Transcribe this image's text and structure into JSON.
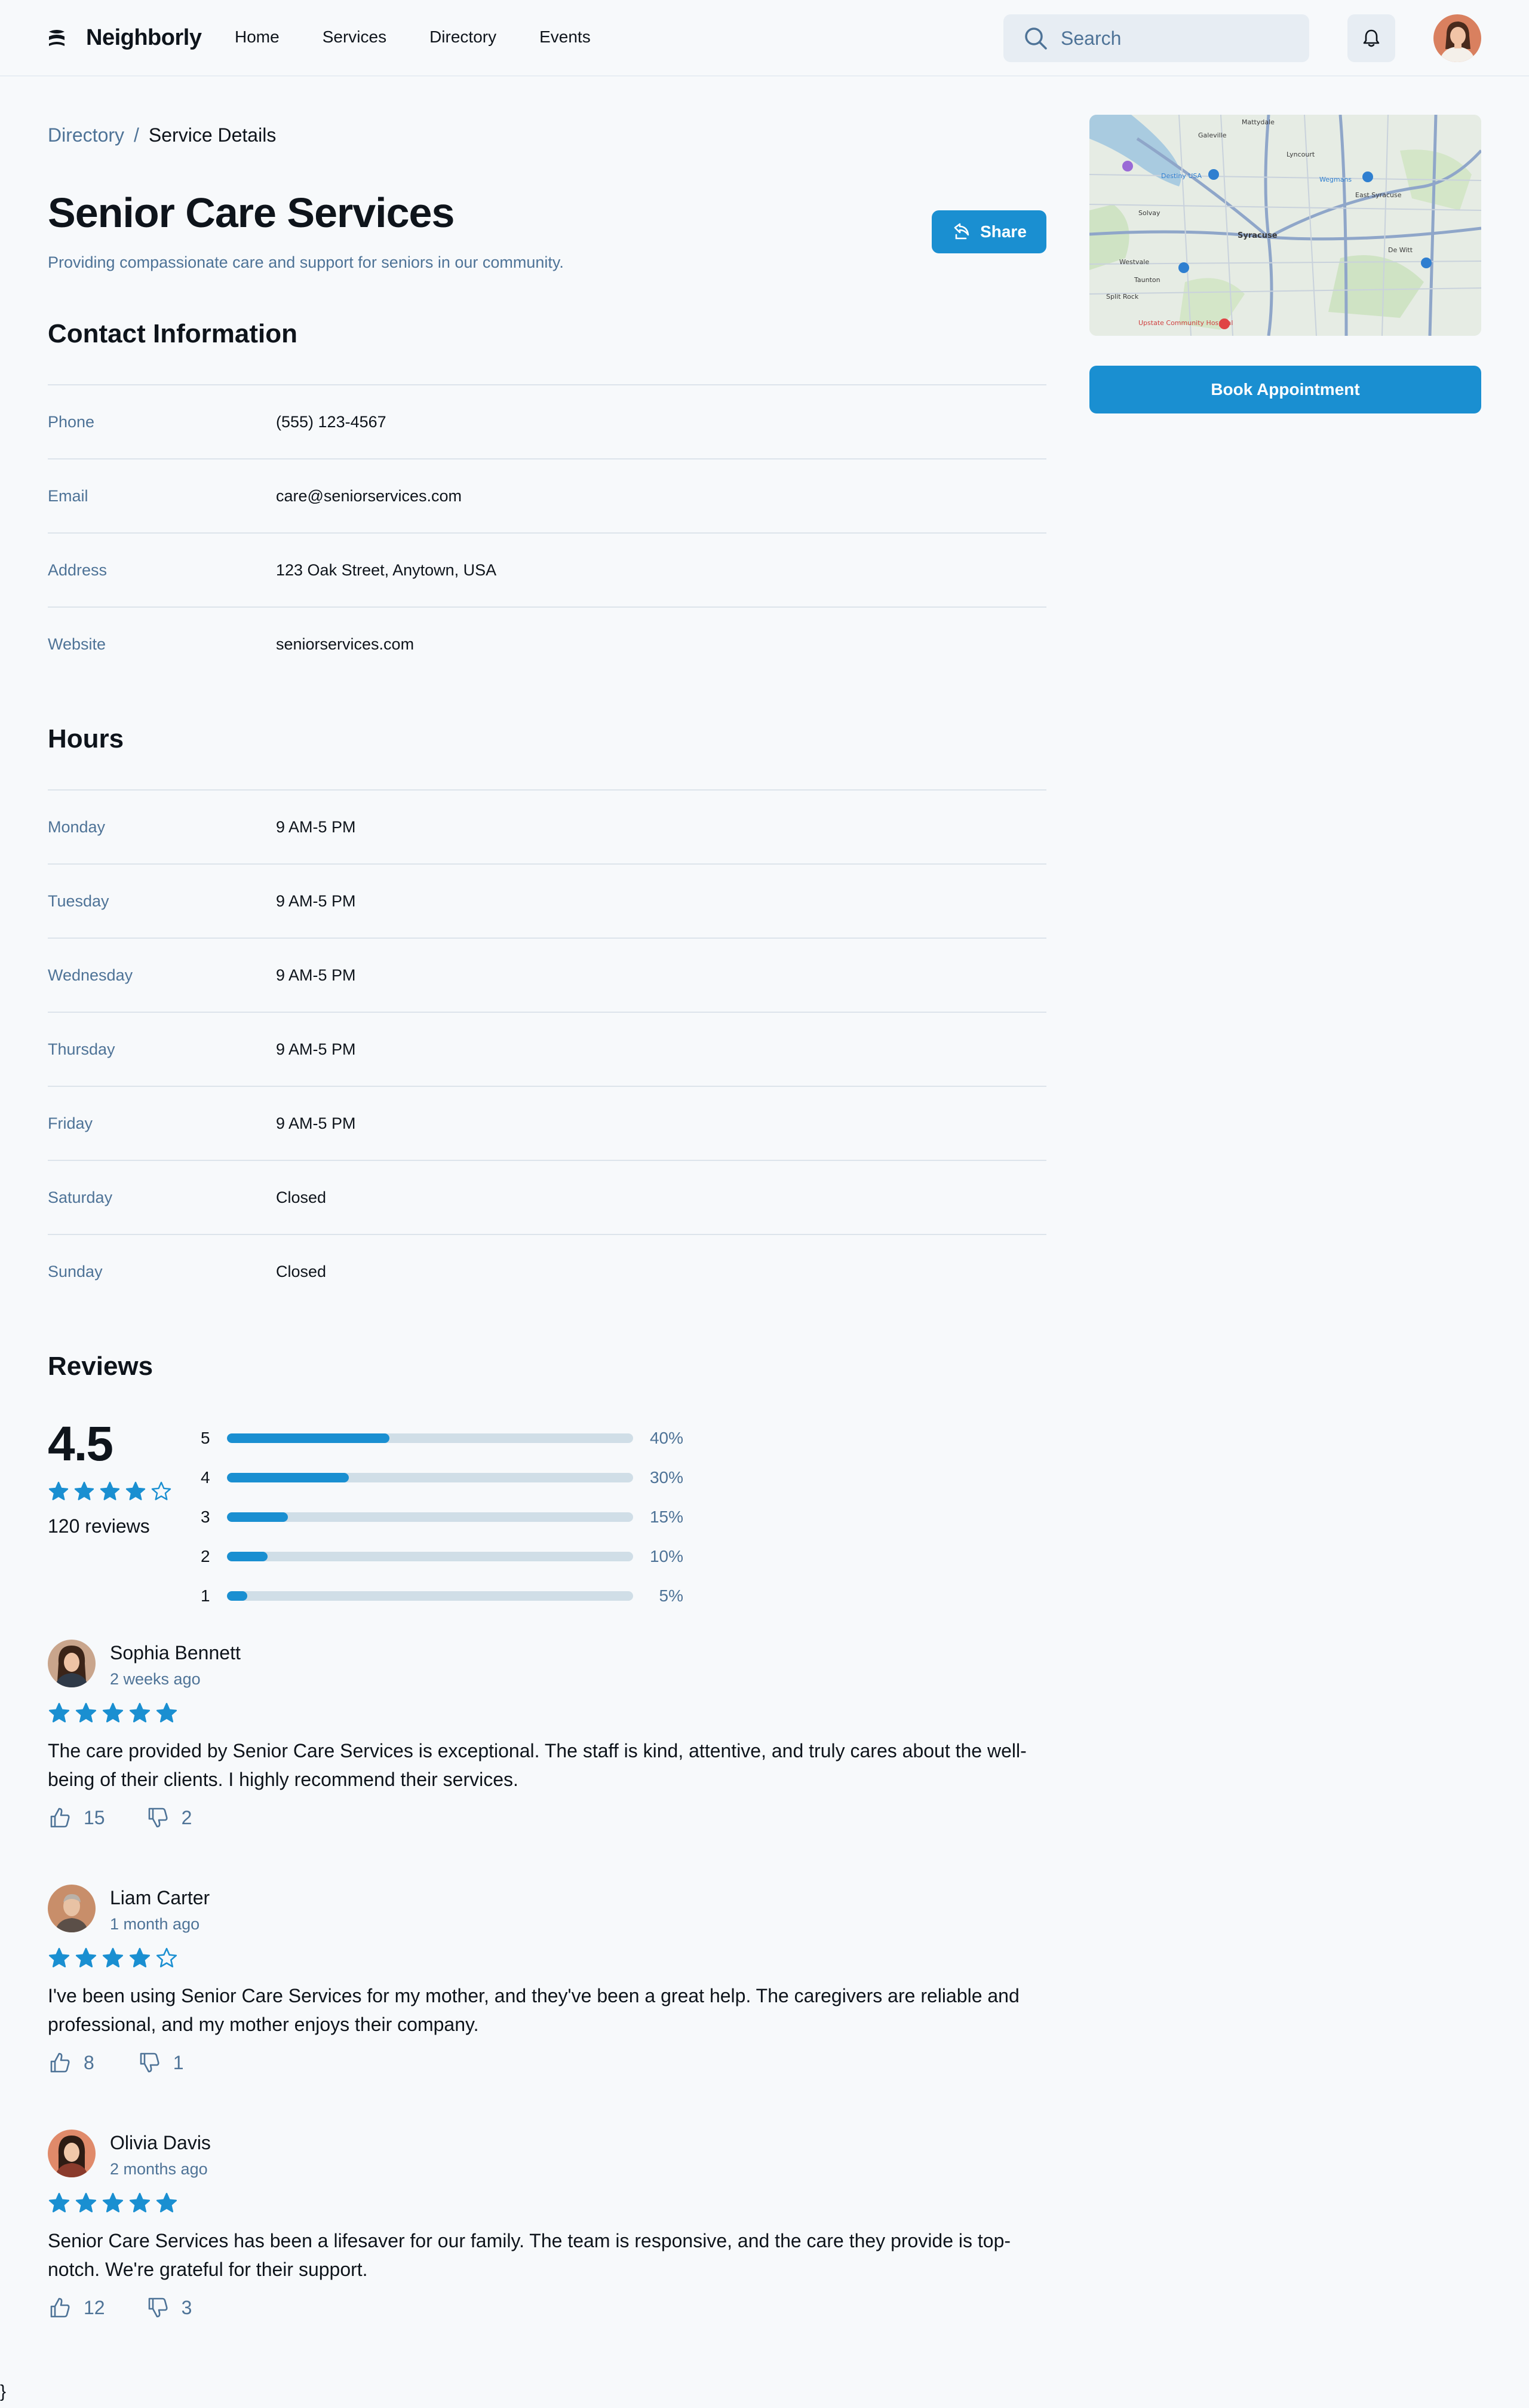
{
  "header": {
    "brand": "Neighborly",
    "nav": [
      "Home",
      "Services",
      "Directory",
      "Events"
    ],
    "search_placeholder": "Search"
  },
  "breadcrumb": {
    "parent": "Directory",
    "separator": "/",
    "current": "Service Details"
  },
  "service": {
    "title": "Senior Care Services",
    "subtitle": "Providing compassionate care and support for seniors in our community.",
    "share_label": "Share",
    "book_label": "Book Appointment"
  },
  "contact": {
    "heading": "Contact Information",
    "rows": [
      {
        "label": "Phone",
        "value": "(555) 123-4567"
      },
      {
        "label": "Email",
        "value": "care@seniorservices.com"
      },
      {
        "label": "Address",
        "value": "123 Oak Street, Anytown, USA"
      },
      {
        "label": "Website",
        "value": "seniorservices.com"
      }
    ]
  },
  "hours": {
    "heading": "Hours",
    "rows": [
      {
        "label": "Monday",
        "value": "9 AM-5 PM"
      },
      {
        "label": "Tuesday",
        "value": "9 AM-5 PM"
      },
      {
        "label": "Wednesday",
        "value": "9 AM-5 PM"
      },
      {
        "label": "Thursday",
        "value": "9 AM-5 PM"
      },
      {
        "label": "Friday",
        "value": "9 AM-5 PM"
      },
      {
        "label": "Saturday",
        "value": "Closed"
      },
      {
        "label": "Sunday",
        "value": "Closed"
      }
    ]
  },
  "reviews_summary": {
    "heading": "Reviews",
    "rating": "4.5",
    "stars": 4.5,
    "count_label": "120 reviews",
    "distribution": [
      {
        "stars": "5",
        "percent": 40,
        "label": "40%"
      },
      {
        "stars": "4",
        "percent": 30,
        "label": "30%"
      },
      {
        "stars": "3",
        "percent": 15,
        "label": "15%"
      },
      {
        "stars": "2",
        "percent": 10,
        "label": "10%"
      },
      {
        "stars": "1",
        "percent": 5,
        "label": "5%"
      }
    ]
  },
  "reviews": [
    {
      "name": "Sophia Bennett",
      "date": "2 weeks ago",
      "stars": 5,
      "text": "The care provided by Senior Care Services is exceptional. The staff is kind, attentive, and truly cares about the well-being of their clients. I highly recommend their services.",
      "likes": "15",
      "dislikes": "2"
    },
    {
      "name": "Liam Carter",
      "date": "1 month ago",
      "stars": 4,
      "text": "I've been using Senior Care Services for my mother, and they've been a great help. The caregivers are reliable and professional, and my mother enjoys their company.",
      "likes": "8",
      "dislikes": "1"
    },
    {
      "name": "Olivia Davis",
      "date": "2 months ago",
      "stars": 5,
      "text": "Senior Care Services has been a lifesaver for our family. The team is responsive, and the care they provide is top-notch. We're grateful for their support.",
      "likes": "12",
      "dislikes": "3"
    }
  ],
  "map_labels": [
    "Mattydale",
    "Galeville",
    "Lyncourt",
    "Wegmans",
    "East Syracuse",
    "Solvay",
    "Syracuse",
    "De Witt",
    "Westvale",
    "Taunton",
    "Split Rock",
    "Destiny USA",
    "Upstate Community Hospital"
  ],
  "stray_char": "}",
  "colors": {
    "accent": "#1a8fd1",
    "muted": "#4e7397",
    "text": "#0e141b",
    "divider": "#dde4eb",
    "field": "#e7edf3"
  }
}
